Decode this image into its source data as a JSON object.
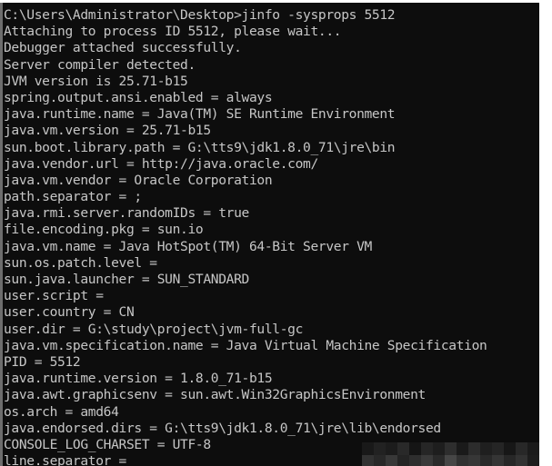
{
  "terminal": {
    "type": "windows-command-prompt",
    "background_color": "#0d0d0d",
    "text_color": "#c6c6c6",
    "command": "jinfo -sysprops 5512",
    "lines": [
      "C:\\Users\\Administrator\\Desktop>jinfo -sysprops 5512",
      "Attaching to process ID 5512, please wait...",
      "Debugger attached successfully.",
      "Server compiler detected.",
      "JVM version is 25.71-b15",
      "spring.output.ansi.enabled = always",
      "java.runtime.name = Java(TM) SE Runtime Environment",
      "java.vm.version = 25.71-b15",
      "sun.boot.library.path = G:\\tts9\\jdk1.8.0_71\\jre\\bin",
      "java.vendor.url = http://java.oracle.com/",
      "java.vm.vendor = Oracle Corporation",
      "path.separator = ;",
      "java.rmi.server.randomIDs = true",
      "file.encoding.pkg = sun.io",
      "java.vm.name = Java HotSpot(TM) 64-Bit Server VM",
      "sun.os.patch.level =",
      "sun.java.launcher = SUN_STANDARD",
      "user.script =",
      "user.country = CN",
      "user.dir = G:\\study\\project\\jvm-full-gc",
      "java.vm.specification.name = Java Virtual Machine Specification",
      "PID = 5512",
      "java.runtime.version = 1.8.0_71-b15",
      "java.awt.graphicsenv = sun.awt.Win32GraphicsEnvironment",
      "os.arch = amd64",
      "java.endorsed.dirs = G:\\tts9\\jdk1.8.0_71\\jre\\lib\\endorsed",
      "CONSOLE_LOG_CHARSET = UTF-8",
      "line.separator ="
    ]
  },
  "redaction": {
    "label": "pixelated-watermark-block"
  }
}
